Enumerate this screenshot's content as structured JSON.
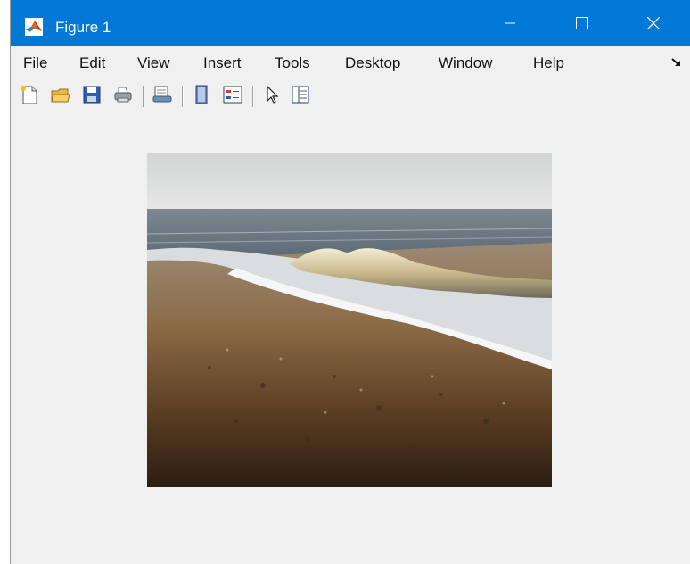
{
  "window": {
    "title": "Figure 1"
  },
  "menu": [
    "File",
    "Edit",
    "View",
    "Insert",
    "Tools",
    "Desktop",
    "Window",
    "Help"
  ],
  "toolbar": [
    {
      "name": "new-figure-icon"
    },
    {
      "name": "open-file-icon"
    },
    {
      "name": "save-figure-icon"
    },
    {
      "name": "print-figure-icon"
    },
    {
      "name": "link-plot-icon"
    },
    {
      "name": "insert-colorbar-icon"
    },
    {
      "name": "insert-legend-icon"
    },
    {
      "name": "edit-plot-pointer-icon"
    },
    {
      "name": "property-inspector-icon"
    }
  ],
  "colors": {
    "titlebar": "#0078d7",
    "window_bg": "#f0f0f0"
  },
  "figure": {
    "image_content": "photo-beach-waves"
  }
}
